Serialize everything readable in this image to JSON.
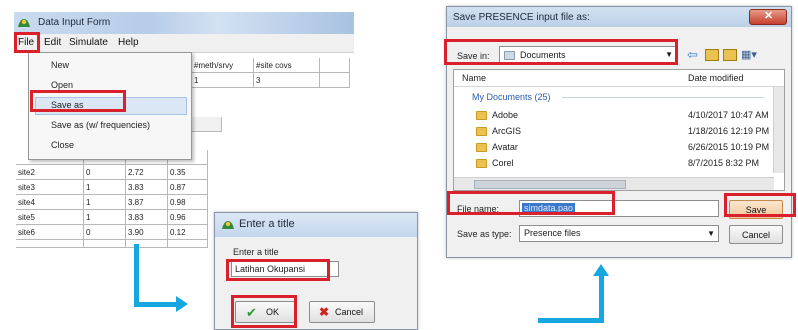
{
  "data_input_form": {
    "title": "Data Input Form",
    "menu": [
      "File",
      "Edit",
      "Simulate",
      "Help"
    ],
    "file_menu": [
      "New",
      "Open",
      "Save as",
      "Save as (w/ frequencies)",
      "Close"
    ],
    "grid_headers": [
      "#meth/srvy",
      "#site covs"
    ],
    "grid_header_values": [
      "1",
      "3"
    ],
    "rows": [
      [
        "site2",
        "0",
        "2.72",
        "0.35"
      ],
      [
        "site3",
        "1",
        "3.83",
        "0.87"
      ],
      [
        "site4",
        "1",
        "3.87",
        "0.98"
      ],
      [
        "site5",
        "1",
        "3.83",
        "0.96"
      ],
      [
        "site6",
        "0",
        "3.90",
        "0.12"
      ]
    ]
  },
  "enter_title_dialog": {
    "title": "Enter a title",
    "prompt": "Enter a title",
    "value": "Latihan Okupansi",
    "ok_label": "OK",
    "cancel_label": "Cancel"
  },
  "save_dialog": {
    "title": "Save PRESENCE input file as:",
    "save_in_label": "Save in:",
    "save_in_value": "Documents",
    "col_name": "Name",
    "col_date": "Date modified",
    "group_label": "My Documents (25)",
    "files": [
      {
        "name": "Adobe",
        "date": "4/10/2017 10:47 AM"
      },
      {
        "name": "ArcGIS",
        "date": "1/18/2016 12:19 PM"
      },
      {
        "name": "Avatar",
        "date": "6/26/2015 10:19 PM"
      },
      {
        "name": "Corel",
        "date": "8/7/2015 8:32 PM"
      }
    ],
    "filename_label": "File name:",
    "filename_value": "simdata.pao",
    "save_label": "Save",
    "type_label": "Save as type:",
    "type_value": "Presence files",
    "cancel_label": "Cancel"
  },
  "colors": {
    "highlight": "#d9202b",
    "arrow": "#16a6e0"
  }
}
